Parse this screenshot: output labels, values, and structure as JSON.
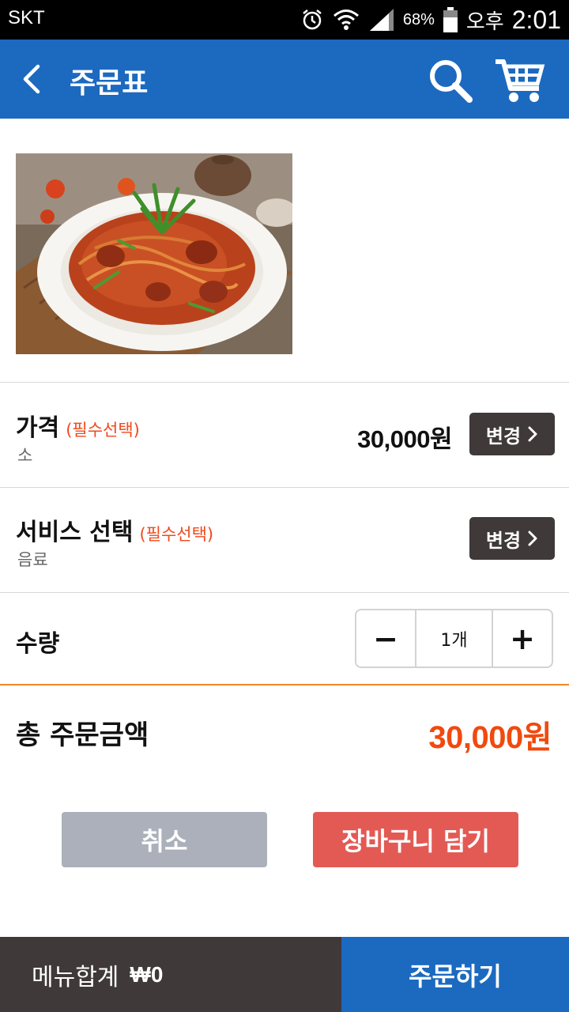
{
  "status_bar": {
    "carrier": "SKT",
    "battery_percent": "68%",
    "ampm": "오후",
    "time": "2:01",
    "icons": [
      "alarm-icon",
      "wifi-icon",
      "signal-icon",
      "battery-icon"
    ]
  },
  "header": {
    "title": "주문표",
    "icons": [
      "back-arrow-icon",
      "search-icon",
      "cart-icon"
    ],
    "color": "#1c69c0"
  },
  "product": {
    "image_subject": "spicy noodle dish on a white plate"
  },
  "price_option": {
    "label": "가격",
    "required": "(필수선택)",
    "selected": "소",
    "price": "30,000원",
    "change_label": "변경"
  },
  "service_option": {
    "label": "서비스 선택",
    "required": "(필수선택)",
    "selected": "음료",
    "change_label": "변경"
  },
  "quantity": {
    "label": "수량",
    "minus": "−",
    "value": "1개",
    "plus": "+"
  },
  "total": {
    "label": "총 주문금액",
    "amount": "30,000원",
    "color": "#f04a0e"
  },
  "actions": {
    "cancel": "취소",
    "add_to_cart": "장바구니 담기"
  },
  "bottom_bar": {
    "menu_total_label": "메뉴합계",
    "menu_total_amount": "₩0",
    "order_button": "주문하기"
  }
}
